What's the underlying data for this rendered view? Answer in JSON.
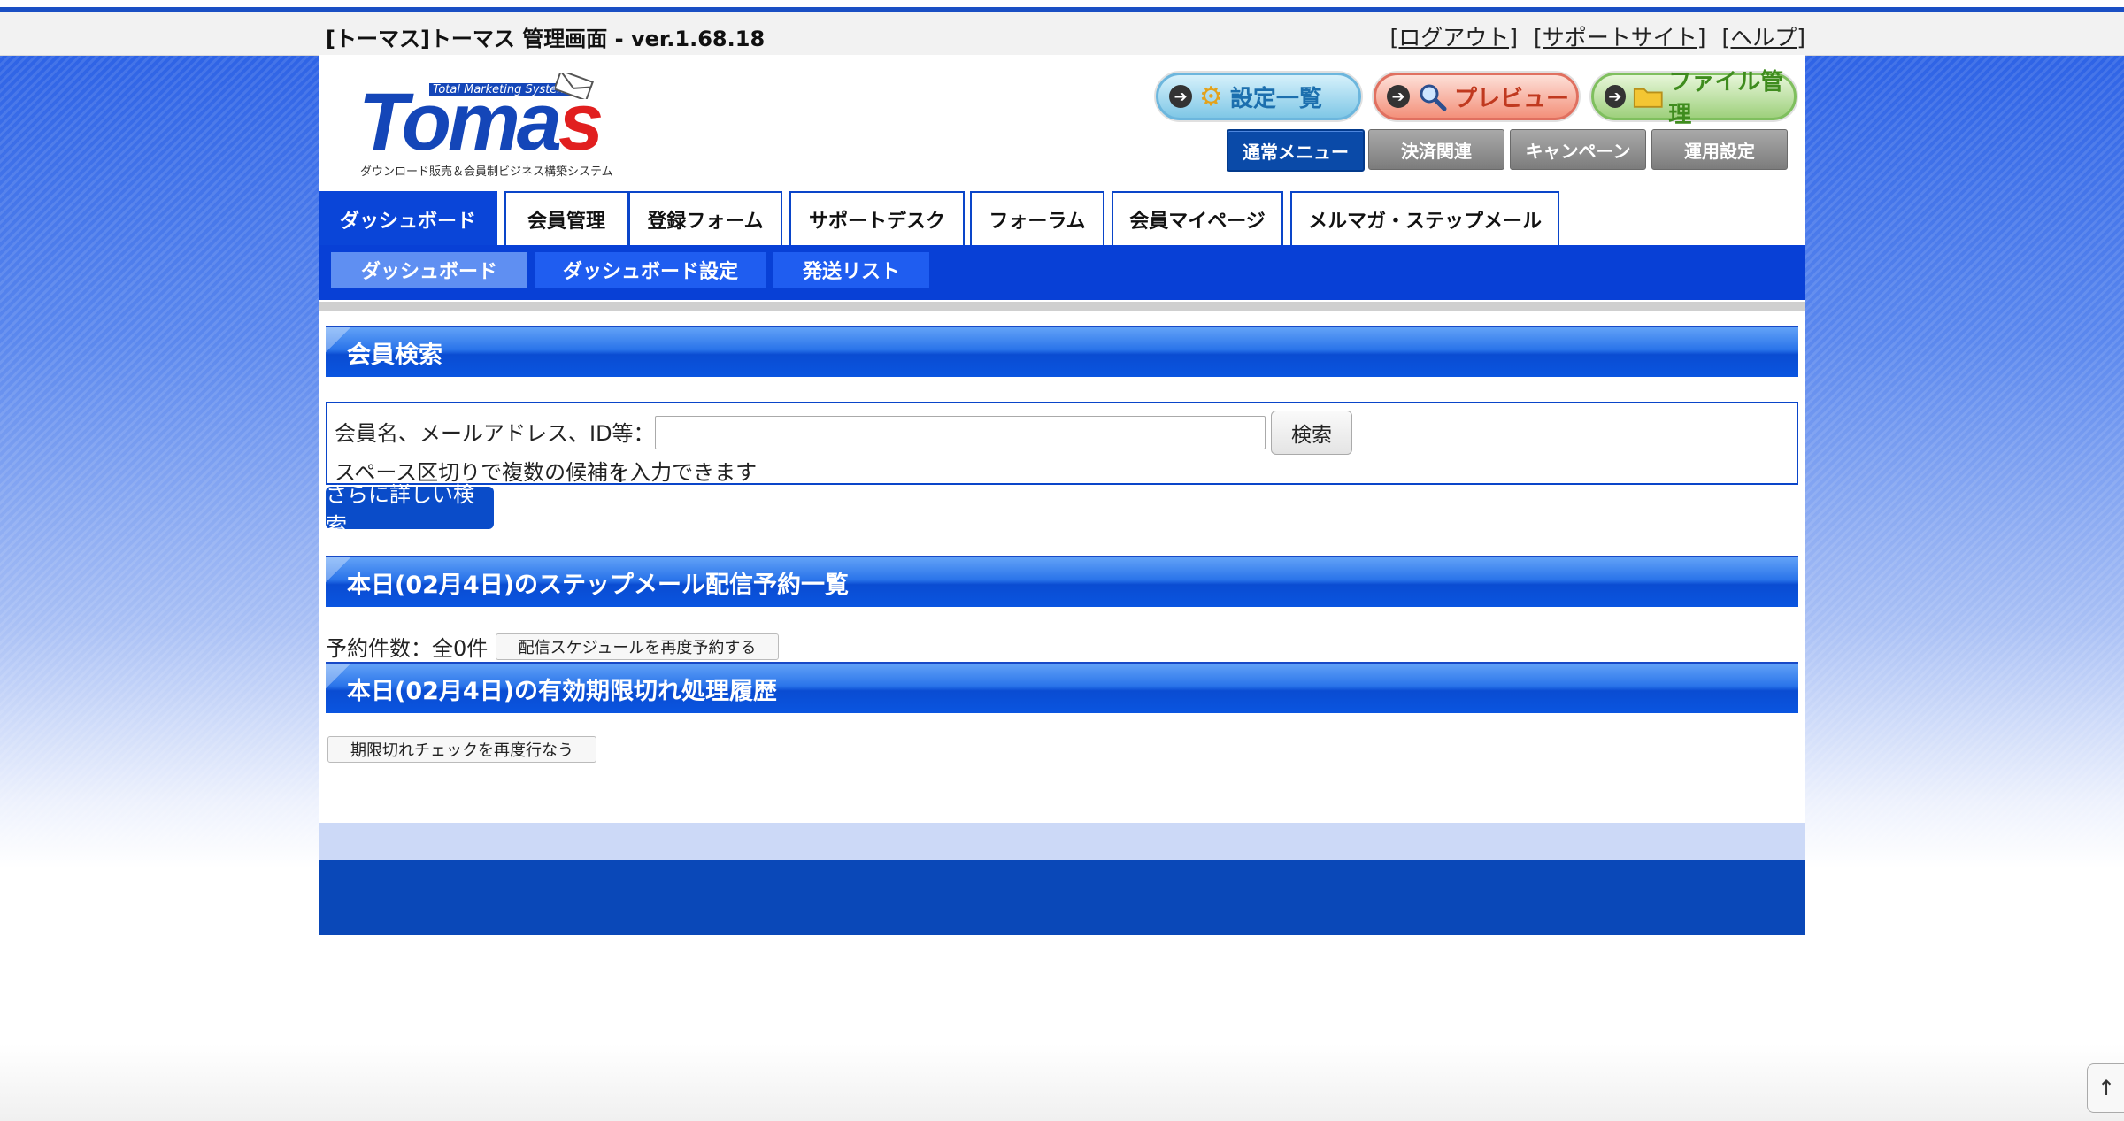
{
  "header": {
    "title": "[トーマス]トーマス 管理画面 - ver.1.68.18",
    "links": [
      "[ログアウト]",
      "[サポートサイト]",
      "[ヘルプ]"
    ]
  },
  "logo": {
    "small_text": "Total Marketing System",
    "main_text": "Tomas",
    "caption": "ダウンロード販売＆会員制ビジネス構築システム"
  },
  "top_buttons": [
    "設定一覧",
    "プレビュー",
    "ファイル管理"
  ],
  "menu_buttons": [
    "通常メニュー",
    "決済関連",
    "キャンペーン",
    "運用設定"
  ],
  "tabs": [
    "ダッシュボード",
    "会員管理",
    "登録フォーム",
    "サポートデスク",
    "フォーラム",
    "会員マイページ",
    "メルマガ・ステップメール"
  ],
  "subtabs": [
    "ダッシュボード",
    "ダッシュボード設定",
    "発送リスト"
  ],
  "search": {
    "heading": "会員検索",
    "label": "会員名、メールアドレス、ID等：",
    "value": "",
    "button": "検索",
    "hint": "スペース区切りで複数の候補を入力できます",
    "advanced_button": "さらに詳しい検索"
  },
  "step_mail": {
    "heading": "本日(02月4日)のステップメール配信予約一覧",
    "count_text": "予約件数：全0件",
    "reschedule_button": "配信スケジュールを再度予約する"
  },
  "expiry": {
    "heading": "本日(02月4日)の有効期限切れ処理履歴",
    "recheck_button": "期限切れチェックを再度行なう"
  },
  "scroll_top": "↑"
}
